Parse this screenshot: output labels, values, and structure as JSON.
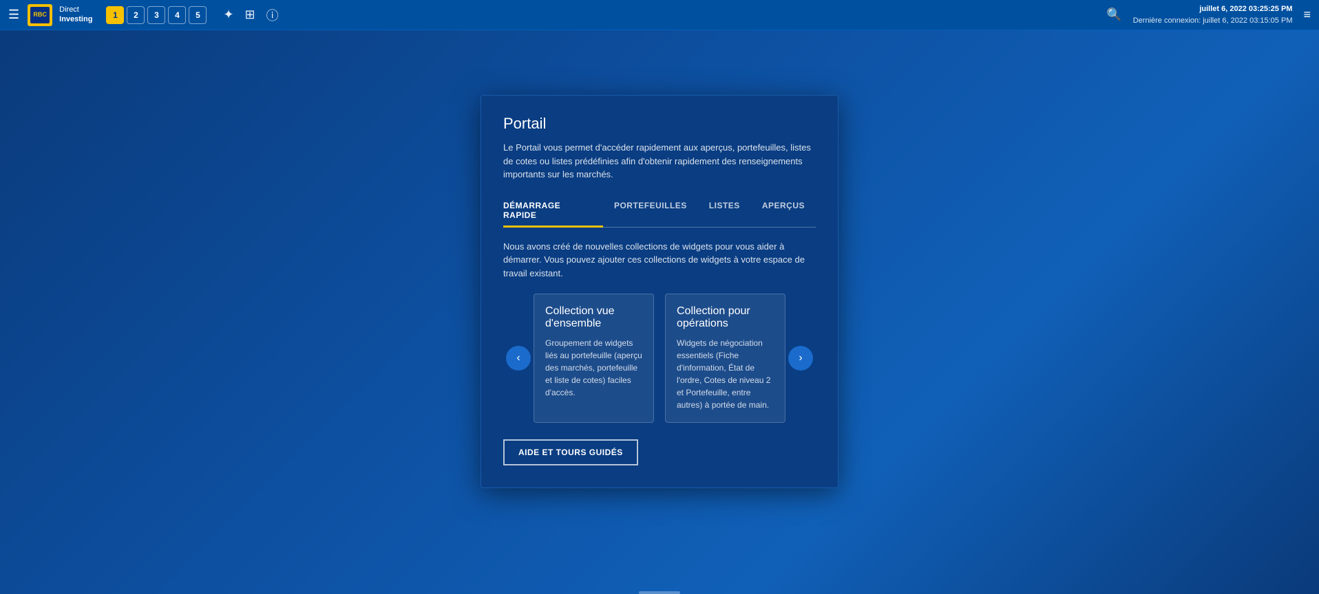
{
  "topbar": {
    "hamburger_label": "☰",
    "brand": {
      "direct": "Direct",
      "investing": "Investing"
    },
    "tabs": [
      {
        "number": "1",
        "active": true
      },
      {
        "number": "2",
        "active": false
      },
      {
        "number": "3",
        "active": false
      },
      {
        "number": "4",
        "active": false
      },
      {
        "number": "5",
        "active": false
      }
    ],
    "icons": {
      "tool": "⚙",
      "layout": "⊞",
      "info": "ℹ"
    },
    "datetime": {
      "current": "juillet 6, 2022 03:25:25 PM",
      "last_login_label": "Dernière connexion: juillet 6, 2022 03:15:05 PM"
    }
  },
  "portail": {
    "title": "Portail",
    "description": "Le Portail vous permet d'accéder rapidement aux aperçus, portefeuilles, listes de cotes ou listes prédéfinies afin d'obtenir rapidement des renseignements importants sur les marchés.",
    "tabs": [
      {
        "id": "demarrage",
        "label": "DÉMARRAGE RAPIDE",
        "active": true
      },
      {
        "id": "portefeuilles",
        "label": "PORTEFEUILLES",
        "active": false
      },
      {
        "id": "listes",
        "label": "LISTES",
        "active": false
      },
      {
        "id": "apercus",
        "label": "APERÇUS",
        "active": false
      }
    ],
    "tabs_description": "Nous avons créé de nouvelles collections de widgets pour vous aider à démarrer. Vous pouvez ajouter ces collections de widgets à votre espace de travail existant.",
    "prev_button": "‹",
    "next_button": "›",
    "cards": [
      {
        "id": "vue-ensemble",
        "title": "Collection vue d'ensemble",
        "description": "Groupement de widgets liés au portefeuille (aperçu des marchés, portefeuille et liste de cotes) faciles d'accès."
      },
      {
        "id": "operations",
        "title": "Collection pour opérations",
        "description": "Widgets de négociation essentiels (Fiche d'information, État de l'ordre, Cotes de niveau 2 et Portefeuille, entre autres) à portée de main."
      }
    ],
    "cta_button_label": "AIDE ET TOURS GUIDÉS"
  }
}
